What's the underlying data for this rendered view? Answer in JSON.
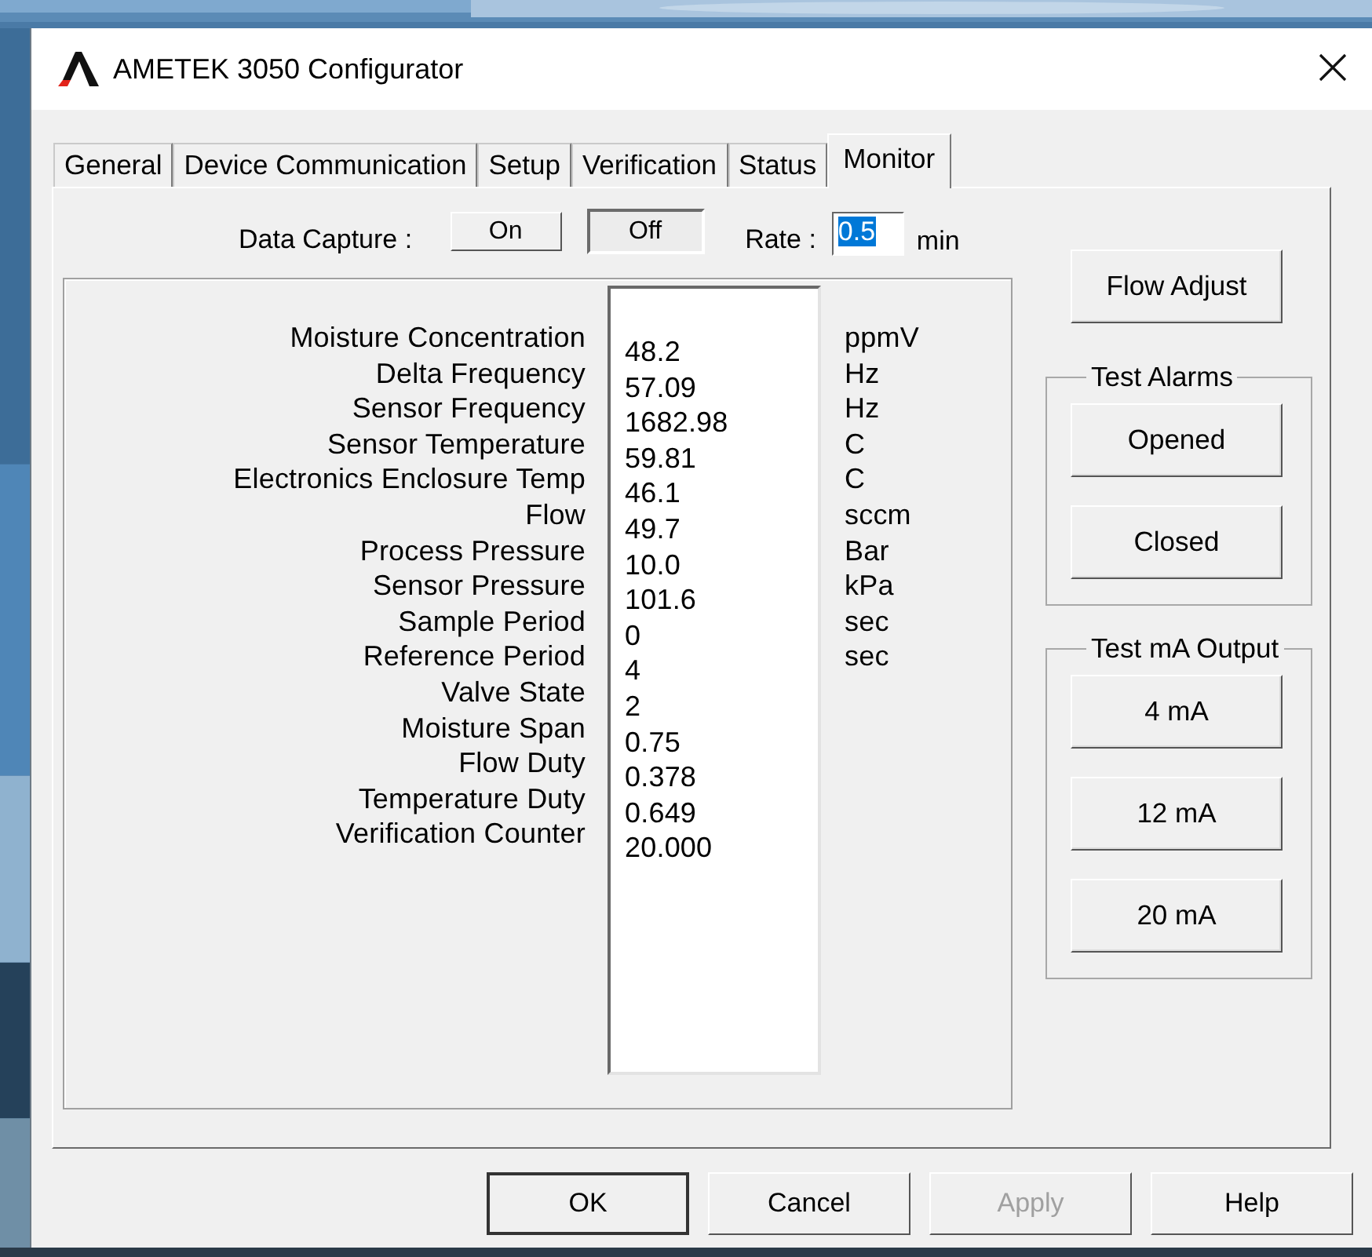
{
  "window": {
    "title": "AMETEK 3050 Configurator"
  },
  "tabs": [
    {
      "label": "General",
      "selected": false
    },
    {
      "label": "Device Communication",
      "selected": false
    },
    {
      "label": "Setup",
      "selected": false
    },
    {
      "label": "Verification",
      "selected": false
    },
    {
      "label": "Status",
      "selected": false
    },
    {
      "label": "Monitor",
      "selected": true
    }
  ],
  "data_capture": {
    "label": "Data Capture :",
    "options": [
      {
        "label": "On",
        "selected": false
      },
      {
        "label": "Off",
        "selected": true
      }
    ],
    "rate_label": "Rate :",
    "rate": {
      "value": "0.5",
      "highlighted": true
    },
    "rate_unit": "min"
  },
  "readings": [
    {
      "label": "Moisture Concentration",
      "value": "48.2",
      "unit": "ppmV"
    },
    {
      "label": "Delta Frequency",
      "value": "57.09",
      "unit": "Hz"
    },
    {
      "label": "Sensor Frequency",
      "value": "1682.98",
      "unit": "Hz"
    },
    {
      "label": "Sensor Temperature",
      "value": "59.81",
      "unit": "C"
    },
    {
      "label": "Electronics Enclosure Temp",
      "value": "46.1",
      "unit": "C"
    },
    {
      "label": "Flow",
      "value": "49.7",
      "unit": "sccm"
    },
    {
      "label": "Process Pressure",
      "value": "10.0",
      "unit": "Bar"
    },
    {
      "label": "Sensor Pressure",
      "value": "101.6",
      "unit": "kPa"
    },
    {
      "label": "Sample Period",
      "value": "0",
      "unit": "sec"
    },
    {
      "label": "Reference Period",
      "value": "4",
      "unit": "sec"
    },
    {
      "label": "Valve State",
      "value": "2"
    },
    {
      "label": "Moisture Span",
      "value": "0.75"
    },
    {
      "label": "Flow Duty",
      "value": "0.378"
    },
    {
      "label": "Temperature Duty",
      "value": "0.649"
    },
    {
      "label": "Verification Counter",
      "value": "20.000"
    }
  ],
  "flow_adjust": "Flow Adjust",
  "groups": [
    {
      "title": "Test Alarms",
      "buttons": [
        "Opened",
        "Closed"
      ]
    },
    {
      "title": "Test mA Output",
      "buttons": [
        "4 mA",
        "12 mA",
        "20 mA"
      ]
    }
  ],
  "dialog_buttons": [
    {
      "label": "OK",
      "default": true,
      "disabled": false
    },
    {
      "label": "Cancel",
      "default": false,
      "disabled": false
    },
    {
      "label": "Apply",
      "default": false,
      "disabled": true
    },
    {
      "label": "Help",
      "default": false,
      "disabled": false
    }
  ]
}
